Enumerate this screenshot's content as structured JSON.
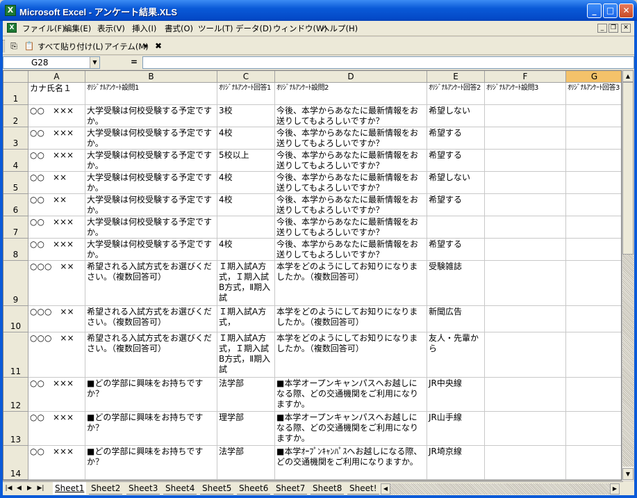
{
  "window": {
    "app_icon": "excel-icon",
    "title": "Microsoft Excel - アンケート結果.XLS",
    "minimize": "_",
    "maximize": "□",
    "close": "✕"
  },
  "menu": {
    "items": [
      "ファイル(F)",
      "編集(E)",
      "表示(V)",
      "挿入(I)",
      "書式(O)",
      "ツール(T)",
      "データ(D)",
      "ウィンドウ(W)",
      "ヘルプ(H)"
    ],
    "doc_min": "_",
    "doc_restore": "❐",
    "doc_close": "✕"
  },
  "toolbar": {
    "paste_all": "すべて貼り付け(L)",
    "items": "アイテム(M)",
    "items_arrow": "▾"
  },
  "formula_bar": {
    "name_box": "G28",
    "equals": "="
  },
  "grid": {
    "columns": [
      "A",
      "B",
      "C",
      "D",
      "E",
      "F",
      "G"
    ],
    "selected_column": "G",
    "rows": [
      {
        "num": "1",
        "cells": [
          "カナ氏名１",
          "ｵﾘｼﾞﾅﾙｱﾝｹｰﾄ設問1",
          "ｵﾘｼﾞﾅﾙｱﾝｹｰﾄ回答1",
          "ｵﾘｼﾞﾅﾙｱﾝｹｰﾄ設問2",
          "ｵﾘｼﾞﾅﾙｱﾝｹｰﾄ回答2",
          "ｵﾘｼﾞﾅﾙｱﾝｹｰﾄ設問3",
          "ｵﾘｼﾞﾅﾙｱﾝｹｰﾄ回答3"
        ]
      },
      {
        "num": "2",
        "cells": [
          "○○　×××",
          "大学受験は何校受験する予定ですか。",
          "3校",
          "今後、本学からあなたに最新情報をお送りしてもよろしいですか？",
          "希望しない",
          "",
          ""
        ]
      },
      {
        "num": "3",
        "cells": [
          "○○　×××",
          "大学受験は何校受験する予定ですか。",
          "4校",
          "今後、本学からあなたに最新情報をお送りしてもよろしいですか？",
          "希望する",
          "",
          ""
        ]
      },
      {
        "num": "4",
        "cells": [
          "○○　×××",
          "大学受験は何校受験する予定ですか。",
          "5校以上",
          "今後、本学からあなたに最新情報をお送りしてもよろしいですか？",
          "希望する",
          "",
          ""
        ]
      },
      {
        "num": "5",
        "cells": [
          "○○　××",
          "大学受験は何校受験する予定ですか。",
          "4校",
          "今後、本学からあなたに最新情報をお送りしてもよろしいですか？",
          "希望しない",
          "",
          ""
        ]
      },
      {
        "num": "6",
        "cells": [
          "○○　××",
          "大学受験は何校受験する予定ですか。",
          "4校",
          "今後、本学からあなたに最新情報をお送りしてもよろしいですか？",
          "希望する",
          "",
          ""
        ]
      },
      {
        "num": "7",
        "cells": [
          "○○　×××",
          "大学受験は何校受験する予定ですか。",
          "",
          "今後、本学からあなたに最新情報をお送りしてもよろしいですか？",
          "",
          "",
          ""
        ]
      },
      {
        "num": "8",
        "cells": [
          "○○　×××",
          "大学受験は何校受験する予定ですか。",
          "4校",
          "今後、本学からあなたに最新情報をお送りしてもよろしいですか？",
          "希望する",
          "",
          ""
        ]
      },
      {
        "num": "9",
        "cells": [
          "○○○　××",
          "希望される入試方式をお選びください。（複数回答可）",
          "Ｉ期入試A方式，Ｉ期入試B方式，Ⅱ期入試",
          "本学をどのようにしてお知りになりましたか。（複数回答可）",
          "受験雑誌",
          "",
          ""
        ]
      },
      {
        "num": "10",
        "cells": [
          "○○○　××",
          "希望される入試方式をお選びください。（複数回答可）",
          "Ｉ期入試A方式，",
          "本学をどのようにしてお知りになりましたか。（複数回答可）",
          "新聞広告",
          "",
          ""
        ]
      },
      {
        "num": "11",
        "cells": [
          "○○○　××",
          "希望される入試方式をお選びください。（複数回答可）",
          "Ｉ期入試A方式，Ｉ期入試B方式，Ⅱ期入試",
          "本学をどのようにしてお知りになりましたか。（複数回答可）",
          "友人・先輩から",
          "",
          ""
        ]
      },
      {
        "num": "12",
        "cells": [
          "○○　×××",
          "■どの学部に興味をお持ちですか？",
          "法学部",
          "■本学オープンキャンパスへお越しになる際、どの交通機関をご利用になりますか。",
          "JR中央線",
          "",
          ""
        ]
      },
      {
        "num": "13",
        "cells": [
          "○○　×××",
          "■どの学部に興味をお持ちですか？",
          "理学部",
          "■本学オープンキャンパスへお越しになる際、どの交通機関をご利用になりますか。",
          "JR山手線",
          "",
          ""
        ]
      },
      {
        "num": "14",
        "cells": [
          "○○　×××",
          "■どの学部に興味をお持ちですか？",
          "法学部",
          "■本学ｵｰﾌﾟﾝｷｬﾝﾊﾟｽへお越しになる際、どの交通機関をご利用になりますか。",
          "JR埼京線",
          "",
          ""
        ]
      }
    ]
  },
  "sheets": {
    "nav": [
      "|◀",
      "◀",
      "▶",
      "▶|"
    ],
    "tabs": [
      "Sheet1",
      "Sheet2",
      "Sheet3",
      "Sheet4",
      "Sheet5",
      "Sheet6",
      "Sheet7",
      "Sheet8",
      "Sheet!"
    ],
    "active": "Sheet1"
  },
  "scroll": {
    "up": "▲",
    "down": "▼",
    "left": "◀",
    "right": "▶"
  }
}
